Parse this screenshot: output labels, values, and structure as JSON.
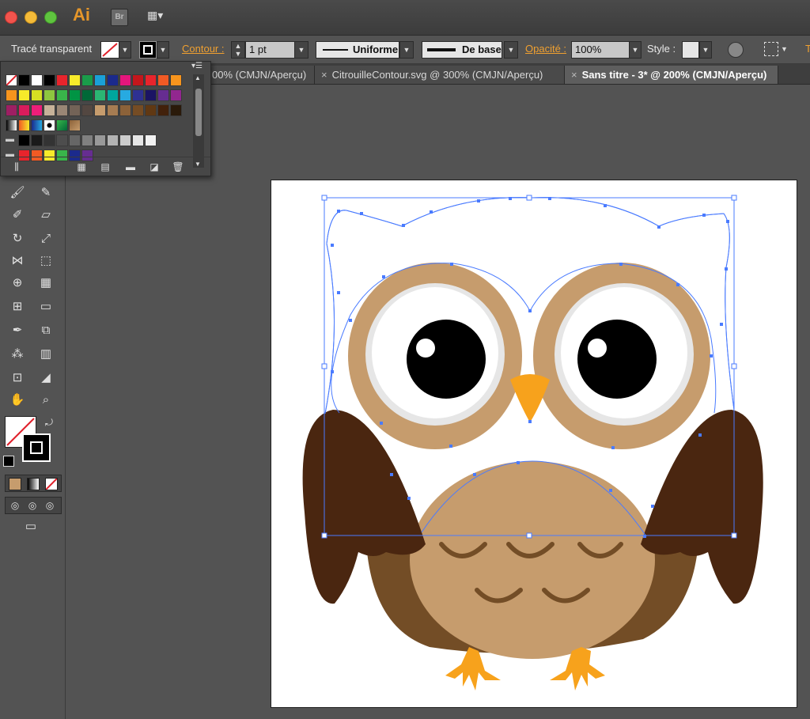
{
  "app": {
    "logo_text": "Ai",
    "bridge_label": "Br",
    "workspace_label": "▦▾"
  },
  "control_bar": {
    "selection_label": "Tracé transparent",
    "stroke_label": "Contour :",
    "stroke_weight": "1 pt",
    "profile": "Uniforme",
    "brush": "De base",
    "opacity_label": "Opacité :",
    "opacity_value": "100%",
    "style_label": "Style :",
    "trailing_label": "T"
  },
  "tabs": [
    {
      "label": "00% (CMJN/Aperçu)",
      "close": "",
      "active": false
    },
    {
      "label": "CitrouilleContour.svg @ 300% (CMJN/Aperçu)",
      "close": "×",
      "active": false
    },
    {
      "label": "Sans titre - 3* @ 200% (CMJN/Aperçu)",
      "close": "×",
      "active": true
    }
  ],
  "swatch_panel": {
    "menu_icon": "panel-menu-icon",
    "rows": [
      [
        "none",
        "#000000",
        "#ffffff",
        "#000000",
        "#e8242c",
        "#f7ea2a",
        "#1a9c4a",
        "#1aa0d8",
        "#1b2a8c",
        "#e4167c",
        "#c4161c",
        "#e8242c",
        "#f15a24",
        "#f7941d"
      ],
      [
        "#f7941d",
        "#f7ea2a",
        "#d7df23",
        "#8dc63f",
        "#39b54a",
        "#009444",
        "#006837",
        "#2bb673",
        "#00a79d",
        "#27aae1",
        "#2e3192",
        "#1b1464",
        "#662d91",
        "#92278f"
      ],
      [
        "#9e1f63",
        "#d91c5c",
        "#ed1e79",
        "#c7b299",
        "#998675",
        "#736357",
        "#534741",
        "#c69c6d",
        "#a67c52",
        "#8c6239",
        "#754c24",
        "#603813",
        "#42210b",
        "#2a1a0a"
      ],
      [
        "grad-bw",
        "grad-orange",
        "grad-blue",
        "pattern-dots",
        "pattern-leaf",
        "pattern-wood"
      ],
      [
        "folder",
        "#000000",
        "#1a1a1a",
        "#333333",
        "#4d4d4d",
        "#666666",
        "#808080",
        "#999999",
        "#b3b3b3",
        "#cccccc",
        "#e6e6e6",
        "#f2f2f2"
      ],
      [
        "folder",
        "#e8242c",
        "#f15a24",
        "#f7ea2a",
        "#39b54a",
        "#1b2a8c",
        "#662d91"
      ]
    ]
  },
  "owl_colors": {
    "head": "#ffffff",
    "face": "#c69c6d",
    "eye_ring": "#e6e6e6",
    "pupil": "#000000",
    "beak": "#f7a21c",
    "wing": "#4a2610",
    "body": "#734d26",
    "belly": "#c69c6d",
    "feet": "#f7a21c",
    "selection": "#4a7bff"
  }
}
